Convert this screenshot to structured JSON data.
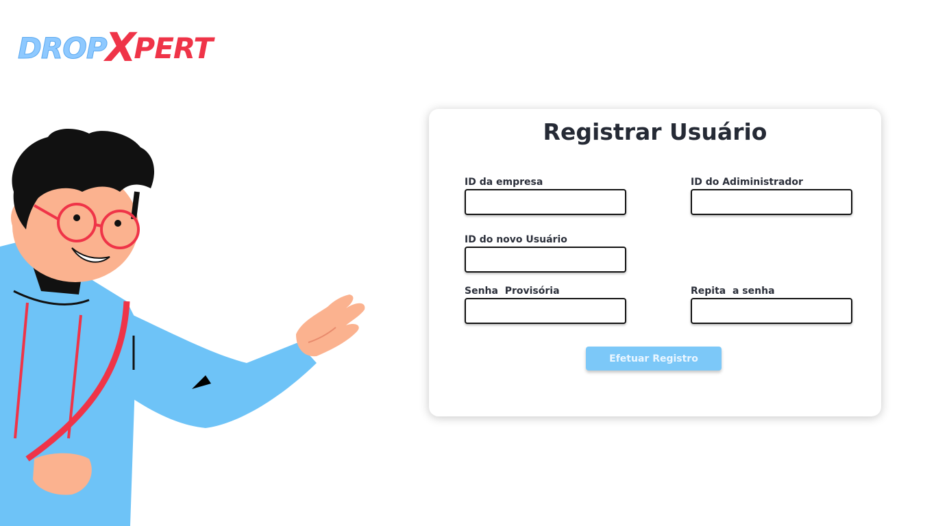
{
  "brand": {
    "part1": "DROP",
    "part2": "X",
    "part3": "PERT"
  },
  "form": {
    "title": "Registrar Usuário",
    "fields": [
      {
        "label": "ID da empresa",
        "value": ""
      },
      {
        "label": "ID do Adiministrador",
        "value": ""
      },
      {
        "label": "ID do novo Usuário",
        "value": ""
      },
      {
        "label": "Senha  Provisória",
        "value": ""
      },
      {
        "label": "Repita  a senha",
        "value": ""
      }
    ],
    "submit_label": "Efetuar Registro"
  },
  "colors": {
    "brand_blue": "#8ec9ff",
    "brand_red": "#ef3448",
    "button": "#7cc8f8"
  },
  "illustration": {
    "name": "waving-man-with-glasses"
  }
}
